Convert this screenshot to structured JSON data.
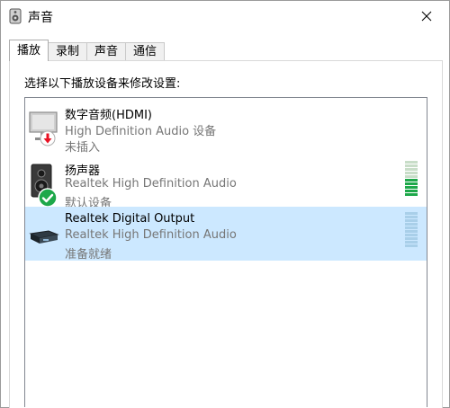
{
  "window": {
    "title": "声音"
  },
  "tabs": [
    {
      "label": "播放",
      "active": true
    },
    {
      "label": "录制",
      "active": false
    },
    {
      "label": "声音",
      "active": false
    },
    {
      "label": "通信",
      "active": false
    }
  ],
  "instruction": "选择以下播放设备来修改设置:",
  "devices": [
    {
      "name": "数字音频(HDMI)",
      "description": "High Definition Audio 设备",
      "status": "未插入",
      "icon": "monitor-icon",
      "badge": "unplugged-badge-icon",
      "selected": false,
      "level": null
    },
    {
      "name": "扬声器",
      "description": "Realtek High Definition Audio",
      "status": "默认设备",
      "icon": "speaker-icon",
      "badge": "default-check-badge-icon",
      "selected": false,
      "level": 0.5
    },
    {
      "name": "Realtek Digital Output",
      "description": "Realtek High Definition Audio",
      "status": "准备就绪",
      "icon": "digital-output-icon",
      "badge": null,
      "selected": true,
      "level": 0
    }
  ],
  "colors": {
    "selection": "#cce8ff",
    "meter_active": "#1ea84a",
    "check_badge": "#1ea84a",
    "unplugged_badge": "#e81123"
  }
}
